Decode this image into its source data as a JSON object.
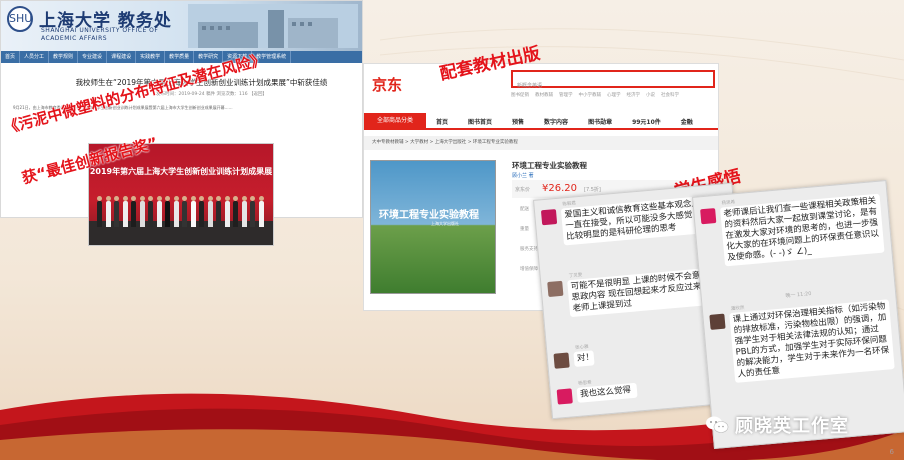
{
  "university_news": {
    "site_name": "上海大学 教务处",
    "site_subtitle": "SHANGHAI UNIVERSITY OFFICE OF ACADEMIC AFFAIRS",
    "nav": [
      "首页",
      "人员分工",
      "教学规则",
      "专业建设",
      "课程建设",
      "实践教学",
      "教学质量",
      "教学研究",
      "资源下载",
      "教学管理系统"
    ],
    "headline": "我校师生在“2019年第六届上海大学生创新创业训练计划成果展”中斩获佳绩",
    "meta": "发布时间：2019-09-24 稿件 浏览次数：116 【返回】",
    "body": "9月21日，由上海市教育委员会主办……上海大学生创新创业训练计划成果展暨第六届上海市大学生创新创业成果展开幕……",
    "photo_banner": "2019年第六届上海大学生创新创业训练计划成果展"
  },
  "overlay_award": {
    "line1": "《污泥中微塑料的分布特征及潜在风险》",
    "line2": "获“最佳创新报告奖”"
  },
  "label_textbook": "配套教材出版",
  "jd": {
    "logo": "京东",
    "search_placeholder": "新概念英语",
    "hot_words": [
      "图书促销",
      "教材教辅",
      "管理学",
      "中小学教辅",
      "心理学",
      "经济学",
      "小说",
      "社会科学"
    ],
    "nav_all": "全部商品分类",
    "nav": [
      "首页",
      "图书首页",
      "预售",
      "数字内容",
      "图书勋章",
      "99元10件",
      "金融"
    ],
    "breadcrumb": "大中专教材教辅 > 大学教材 > 上海大学出版社 > 环境工程专业实验教程",
    "cover_title": "环境工程专业实验教程",
    "cover_sub": "上海大学出版社",
    "product_title": "环境工程专业实验教程",
    "author": "顾小兰 著",
    "price_label": "京东价",
    "price": "¥26.20",
    "discount": "[7.5折]",
    "side_labels": [
      "配送",
      "重量",
      "服务支持",
      "增值保障"
    ]
  },
  "label_feedback": "学生感悟",
  "chat_left": {
    "messages": [
      {
        "user": "陈毅君",
        "text": "爱国主义和诚信教育这些基本观念从小就一直在接受，所以可能没多大感觉，感觉比较明显的是科研伦理的思考",
        "avatar_color": "#c2185b"
      },
      {
        "user": "丁灵雯",
        "text": "可能不是很明显 上课的时候不会意识到是思政内容 现在回想起来才反应过来 原来老师上课提到过",
        "avatar_color": "#8d6e63"
      },
      {
        "user": "张心雅",
        "text": "对！",
        "avatar_color": "#6d4c41"
      },
      {
        "user": "杨思希",
        "text": "我也这么觉得",
        "avatar_color": "#d81b60"
      }
    ]
  },
  "chat_right": {
    "time": "晚一 11:20",
    "messages": [
      {
        "user": "杨思希",
        "text": "老师课后让我们查一些课程相关政策相关的资料然后大家一起放到课堂讨论，是有在激发大家对环境的思考的，也进一步强化大家的在环境问题上的环保责任意识以及使命感。(- -)ゞ ∠)_",
        "avatar_color": "#d81b60"
      },
      {
        "user": "潘欣然",
        "text": "课上通过对环保治理相关指标（如污染物的排放标准，污染物检出限）的强调，加强学生对于相关法律法规的认知；通过PBL的方式，加强学生对于实际环保问题的解决能力，学生对于未来作为一名环保人的责任意",
        "avatar_color": "#5d4037"
      }
    ]
  },
  "watermark": "顾晓英工作室",
  "page_number": "6",
  "colors": {
    "accent_red": "#e4141b",
    "jd_red": "#e1251b",
    "univ_blue": "#3a6ea5"
  }
}
